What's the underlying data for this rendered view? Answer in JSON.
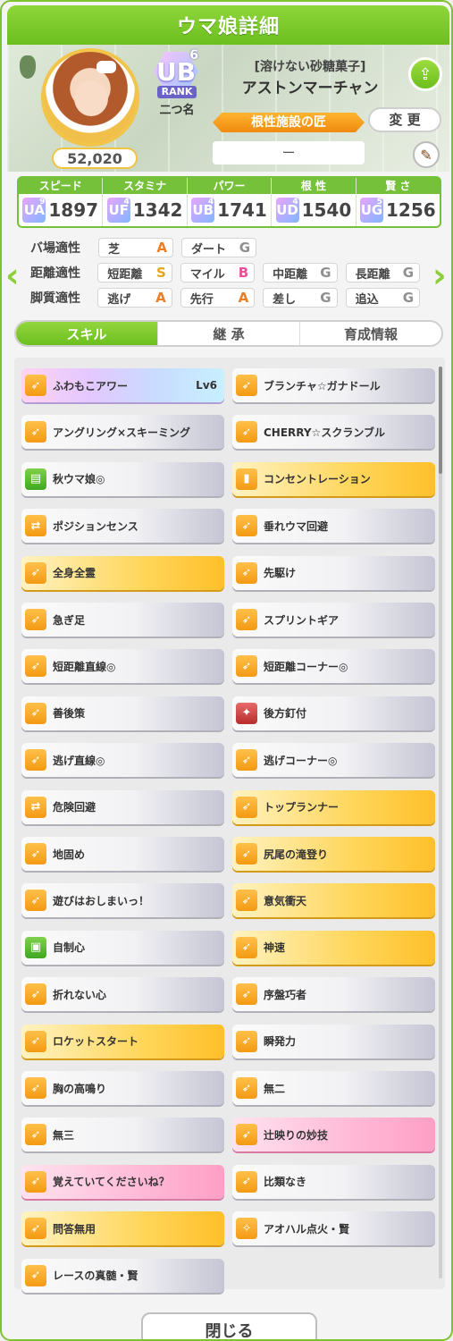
{
  "header": {
    "title": "ウマ娘詳細"
  },
  "profile": {
    "fans": "52,020",
    "rank_grade": "UB",
    "rank_level": "6",
    "rank_label": "RANK",
    "nickname": "二つ名",
    "epithet": "[溶けない砂糖菓子]",
    "name": "アストンマーチャン",
    "title_badge": "根性施設の匠",
    "change_label": "変 更",
    "subtitle_value": "ー"
  },
  "stats": [
    {
      "label": "スピード",
      "grade": "UA",
      "sub": "9",
      "value": "1897"
    },
    {
      "label": "スタミナ",
      "grade": "UF",
      "sub": "4",
      "value": "1342"
    },
    {
      "label": "パワー",
      "grade": "UB",
      "sub": "4",
      "value": "1741"
    },
    {
      "label": "根 性",
      "grade": "UD",
      "sub": "4",
      "value": "1540"
    },
    {
      "label": "賢 さ",
      "grade": "UG",
      "sub": "5",
      "value": "1256"
    }
  ],
  "aptitude": {
    "track": {
      "label": "バ場適性",
      "items": [
        {
          "name": "芝",
          "grade": "A"
        },
        {
          "name": "ダート",
          "grade": "G"
        }
      ]
    },
    "distance": {
      "label": "距離適性",
      "items": [
        {
          "name": "短距離",
          "grade": "S"
        },
        {
          "name": "マイル",
          "grade": "B"
        },
        {
          "name": "中距離",
          "grade": "G"
        },
        {
          "name": "長距離",
          "grade": "G"
        }
      ]
    },
    "style": {
      "label": "脚質適性",
      "items": [
        {
          "name": "逃げ",
          "grade": "A"
        },
        {
          "name": "先行",
          "grade": "A"
        },
        {
          "name": "差し",
          "grade": "G"
        },
        {
          "name": "追込",
          "grade": "G"
        }
      ]
    }
  },
  "tabs": [
    "スキル",
    "継 承",
    "育成情報"
  ],
  "skills": [
    {
      "name": "ふわもこアワー",
      "lv": "Lv6",
      "style": "rainbow",
      "icon": "speed-icon"
    },
    {
      "name": "ブランチャ☆ガナドール",
      "lv": "",
      "style": "plain",
      "icon": "speed-icon"
    },
    {
      "name": "アングリング×スキーミング",
      "lv": "",
      "style": "plain",
      "icon": "speed-icon"
    },
    {
      "name": "CHERRY☆スクランブル",
      "lv": "",
      "style": "plain",
      "icon": "speed-icon"
    },
    {
      "name": "秋ウマ娘◎",
      "lv": "",
      "style": "plain",
      "icon": "condition-icon"
    },
    {
      "name": "コンセントレーション",
      "lv": "",
      "style": "gold",
      "icon": "gate-icon"
    },
    {
      "name": "ポジションセンス",
      "lv": "",
      "style": "plain",
      "icon": "position-icon"
    },
    {
      "name": "垂れウマ回避",
      "lv": "",
      "style": "plain",
      "icon": "speed-icon"
    },
    {
      "name": "全身全霊",
      "lv": "",
      "style": "gold",
      "icon": "speed-icon"
    },
    {
      "name": "先駆け",
      "lv": "",
      "style": "plain",
      "icon": "speed-icon"
    },
    {
      "name": "急ぎ足",
      "lv": "",
      "style": "plain",
      "icon": "speed-icon"
    },
    {
      "name": "スプリントギア",
      "lv": "",
      "style": "plain",
      "icon": "speed-icon"
    },
    {
      "name": "短距離直線◎",
      "lv": "",
      "style": "plain",
      "icon": "speed-icon"
    },
    {
      "name": "短距離コーナー◎",
      "lv": "",
      "style": "plain",
      "icon": "speed-icon"
    },
    {
      "name": "善後策",
      "lv": "",
      "style": "plain",
      "icon": "speed-icon"
    },
    {
      "name": "後方釘付",
      "lv": "",
      "style": "plain",
      "icon": "debuff-icon"
    },
    {
      "name": "逃げ直線◎",
      "lv": "",
      "style": "plain",
      "icon": "speed-icon"
    },
    {
      "name": "逃げコーナー◎",
      "lv": "",
      "style": "plain",
      "icon": "speed-icon"
    },
    {
      "name": "危険回避",
      "lv": "",
      "style": "plain",
      "icon": "position-icon"
    },
    {
      "name": "トップランナー",
      "lv": "",
      "style": "gold",
      "icon": "speed-icon"
    },
    {
      "name": "地固め",
      "lv": "",
      "style": "plain",
      "icon": "speed-icon"
    },
    {
      "name": "尻尾の滝登り",
      "lv": "",
      "style": "gold",
      "icon": "speed-icon"
    },
    {
      "name": "遊びはおしまいっ！",
      "lv": "",
      "style": "plain",
      "icon": "speed-icon"
    },
    {
      "name": "意気衝天",
      "lv": "",
      "style": "gold",
      "icon": "speed-icon"
    },
    {
      "name": "自制心",
      "lv": "",
      "style": "plain",
      "icon": "recovery-icon"
    },
    {
      "name": "神速",
      "lv": "",
      "style": "gold",
      "icon": "speed-icon"
    },
    {
      "name": "折れない心",
      "lv": "",
      "style": "plain",
      "icon": "speed-icon"
    },
    {
      "name": "序盤巧者",
      "lv": "",
      "style": "plain",
      "icon": "speed-icon"
    },
    {
      "name": "ロケットスタート",
      "lv": "",
      "style": "gold",
      "icon": "speed-icon"
    },
    {
      "name": "瞬発力",
      "lv": "",
      "style": "plain",
      "icon": "speed-icon"
    },
    {
      "name": "胸の高鳴り",
      "lv": "",
      "style": "plain",
      "icon": "speed-icon"
    },
    {
      "name": "無二",
      "lv": "",
      "style": "plain",
      "icon": "speed-icon"
    },
    {
      "name": "無三",
      "lv": "",
      "style": "plain",
      "icon": "speed-icon"
    },
    {
      "name": "辻映りの妙技",
      "lv": "",
      "style": "pink",
      "icon": "speed-icon"
    },
    {
      "name": "覚えていてくださいね？",
      "lv": "",
      "style": "pink",
      "icon": "speed-icon"
    },
    {
      "name": "比類なき",
      "lv": "",
      "style": "plain",
      "icon": "speed-icon"
    },
    {
      "name": "問答無用",
      "lv": "",
      "style": "gold",
      "icon": "speed-icon"
    },
    {
      "name": "アオハル点火・賢",
      "lv": "",
      "style": "plain",
      "icon": "aoharu-icon"
    },
    {
      "name": "レースの真髄・賢",
      "lv": "",
      "style": "plain",
      "icon": "speed-icon"
    }
  ],
  "close_label": "閉じる"
}
